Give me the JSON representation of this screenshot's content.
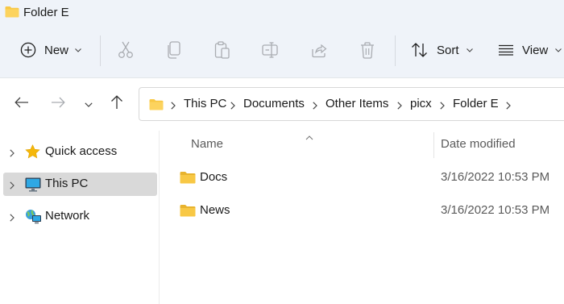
{
  "window": {
    "title": "Folder E"
  },
  "toolbar": {
    "new_label": "New",
    "sort_label": "Sort",
    "view_label": "View",
    "icons": [
      "plus-circle-icon",
      "scissors-icon",
      "copy-icon",
      "paste-icon",
      "rename-icon",
      "share-icon",
      "trash-icon",
      "sort-icon",
      "view-lines-icon"
    ]
  },
  "address": {
    "crumbs": [
      "This PC",
      "Documents",
      "Other Items",
      "picx",
      "Folder E"
    ]
  },
  "sidebar": {
    "items": [
      {
        "label": "Quick access",
        "icon": "star-icon"
      },
      {
        "label": "This PC",
        "icon": "monitor-icon",
        "selected": true
      },
      {
        "label": "Network",
        "icon": "network-icon"
      }
    ]
  },
  "list": {
    "columns": {
      "name": "Name",
      "date": "Date modified"
    },
    "rows": [
      {
        "name": "Docs",
        "date": "3/16/2022 10:53 PM"
      },
      {
        "name": "News",
        "date": "3/16/2022 10:53 PM"
      }
    ]
  },
  "colors": {
    "folder": "#f8c845",
    "star": "#f5b70a",
    "selected": "#d9d9d9",
    "chrome": "#eff3f9"
  }
}
